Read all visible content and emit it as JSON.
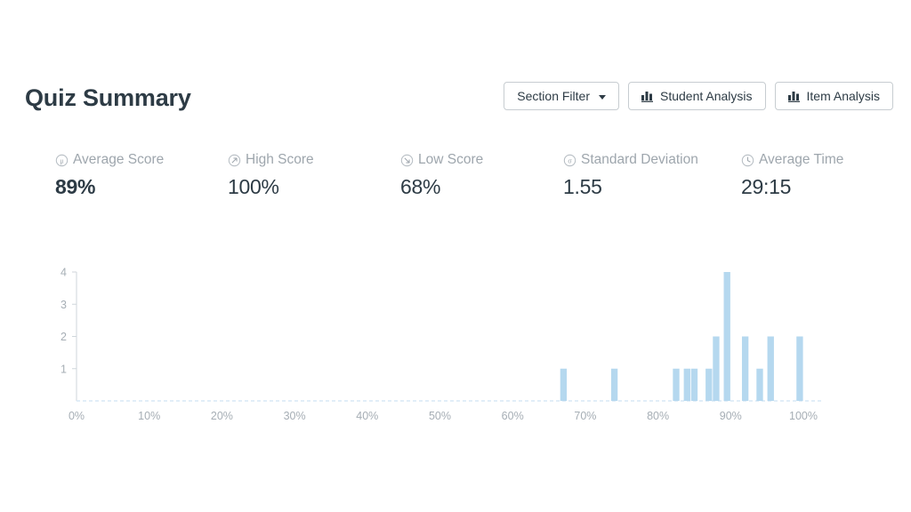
{
  "header": {
    "title": "Quiz Summary",
    "buttons": [
      {
        "label": "Section Filter",
        "icon": "chevron-down-icon",
        "has_caret": true
      },
      {
        "label": "Student Analysis",
        "icon": "bar-chart-icon",
        "has_caret": false
      },
      {
        "label": "Item Analysis",
        "icon": "bar-chart-icon",
        "has_caret": false
      }
    ]
  },
  "stats": [
    {
      "label": "Average Score",
      "value": "89%",
      "icon": "mu-circle-icon",
      "bold": true
    },
    {
      "label": "High Score",
      "value": "100%",
      "icon": "arrow-up-right-circle-icon",
      "bold": false
    },
    {
      "label": "Low Score",
      "value": "68%",
      "icon": "arrow-down-right-circle-icon",
      "bold": false
    },
    {
      "label": "Standard Deviation",
      "value": "1.55",
      "icon": "sigma-circle-icon",
      "bold": false
    },
    {
      "label": "Average Time",
      "value": "29:15",
      "icon": "clock-icon",
      "bold": false
    }
  ],
  "colors": {
    "bar": "#b5d8ef",
    "axis_text": "#a6aeb5",
    "baseline": "#d7e9f6",
    "title": "#2d3b45",
    "button_border": "#c7cdd1"
  },
  "chart_data": {
    "type": "bar",
    "title": "",
    "xlabel": "",
    "ylabel": "",
    "xlim": [
      0,
      100
    ],
    "ylim": [
      0,
      4
    ],
    "grid": false,
    "legend": "none",
    "xtick_labels": [
      "0%",
      "10%",
      "20%",
      "30%",
      "40%",
      "50%",
      "60%",
      "70%",
      "80%",
      "90%",
      "100%"
    ],
    "xtick_values": [
      0,
      10,
      20,
      30,
      40,
      50,
      60,
      70,
      80,
      90,
      100
    ],
    "ytick_labels": [
      "1",
      "2",
      "3",
      "4"
    ],
    "ytick_values": [
      1,
      2,
      3,
      4
    ],
    "x": [
      67,
      74,
      82.5,
      84,
      85,
      87,
      88,
      89.5,
      92,
      94,
      95.5,
      99.5
    ],
    "values": [
      1,
      1,
      1,
      1,
      1,
      1,
      2,
      4,
      2,
      1,
      2,
      2
    ],
    "bar_width_pct": 0.9
  }
}
